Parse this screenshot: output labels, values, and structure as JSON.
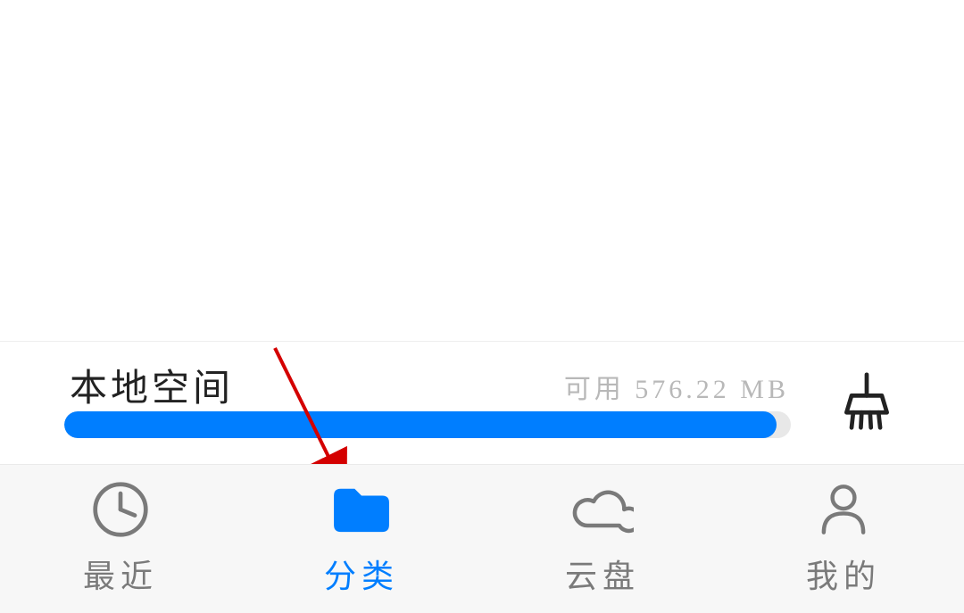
{
  "storage": {
    "title": "本地空间",
    "available": "可用 576.22 MB",
    "progress_percent": 98
  },
  "nav": {
    "items": [
      {
        "label": "最近",
        "icon": "clock-icon"
      },
      {
        "label": "分类",
        "icon": "folder-icon"
      },
      {
        "label": "云盘",
        "icon": "cloud-icon"
      },
      {
        "label": "我的",
        "icon": "person-icon"
      }
    ],
    "active_index": 1
  },
  "clean_button_icon": "broom-icon",
  "colors": {
    "accent": "#007eff",
    "inactive": "#7a7a7a",
    "annotation": "#d40000"
  }
}
